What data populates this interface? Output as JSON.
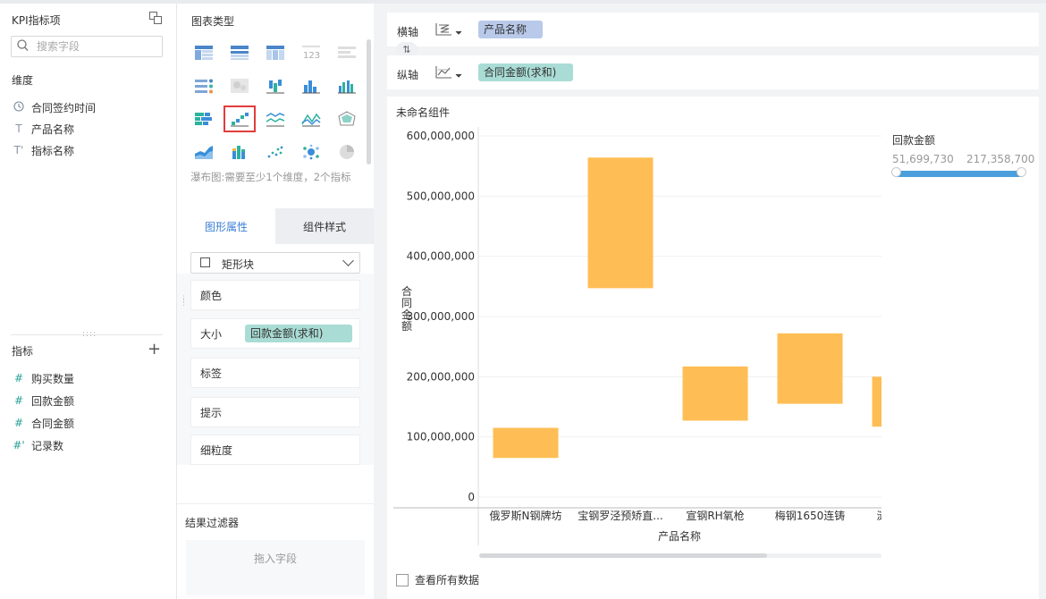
{
  "left_panel": {
    "title": "KPI指标项",
    "search_placeholder": "搜索字段",
    "dimension_label": "维度",
    "dimensions": [
      {
        "icon": "clock-icon",
        "glyph": "🕓",
        "label": "合同签约时间"
      },
      {
        "icon": "text-type-icon",
        "glyph": "T",
        "label": "产品名称"
      },
      {
        "icon": "text-type-icon",
        "glyph": "T'",
        "label": "指标名称"
      }
    ],
    "metric_label": "指标",
    "metrics": [
      {
        "icon": "hash-icon",
        "glyph": "#",
        "label": "购买数量"
      },
      {
        "icon": "hash-icon",
        "glyph": "#",
        "label": "回款金额"
      },
      {
        "icon": "hash-icon",
        "glyph": "#",
        "label": "合同金额"
      },
      {
        "icon": "hash-icon",
        "glyph": "#'",
        "label": "记录数"
      }
    ]
  },
  "chart_type_panel": {
    "title": "图表类型",
    "hint": "瀑布图:需要至少1个维度，2个指标",
    "selected_icon": "waterfall-chart-icon"
  },
  "properties": {
    "tab_graphic": "图形属性",
    "tab_component": "组件样式",
    "mark_type": "矩形块",
    "color_label": "颜色",
    "size_label": "大小",
    "size_field": "回款金额(求和)",
    "label_label": "标签",
    "tooltip_label": "提示",
    "granularity_label": "细粒度"
  },
  "result_filter": {
    "title": "结果过滤器",
    "drop_text": "拖入字段"
  },
  "axes": {
    "x_label": "横轴",
    "x_field": "产品名称",
    "y_label": "纵轴",
    "y_field": "合同金额(求和)"
  },
  "component": {
    "title": "未命名组件",
    "view_all_label": "查看所有数据"
  },
  "legend": {
    "title": "回款金额",
    "min": "51,699,730",
    "max": "217,358,700"
  },
  "colors": {
    "bar": "#ffbe55",
    "accent": "#3c7fd6",
    "teal_pill": "#a9dcd5",
    "blue_pill": "#b9c9ea",
    "legend_bar": "#4a9fdc"
  },
  "chart_data": {
    "type": "bar",
    "subtype": "waterfall",
    "xlabel": "产品名称",
    "ylabel": "合同金额",
    "ylim": [
      0,
      600000000
    ],
    "yticks": [
      "600,000,000",
      "500,000,000",
      "400,000,000",
      "300,000,000",
      "200,000,000",
      "100,000,000",
      "0"
    ],
    "ytick_values": [
      600000000,
      500000000,
      400000000,
      300000000,
      200000000,
      100000000,
      0
    ],
    "categories": [
      "俄罗斯N钢牌坊",
      "宝钢罗泾预矫直...",
      "宣钢RH氧枪",
      "梅钢1650连铸",
      "涟钢"
    ],
    "bars": [
      {
        "low": 65000000,
        "high": 115000000
      },
      {
        "low": 347000000,
        "high": 564000000
      },
      {
        "low": 127000000,
        "high": 217000000
      },
      {
        "low": 155000000,
        "high": 272000000
      },
      {
        "low": 117000000,
        "high": 200000000
      }
    ],
    "grid": true
  }
}
